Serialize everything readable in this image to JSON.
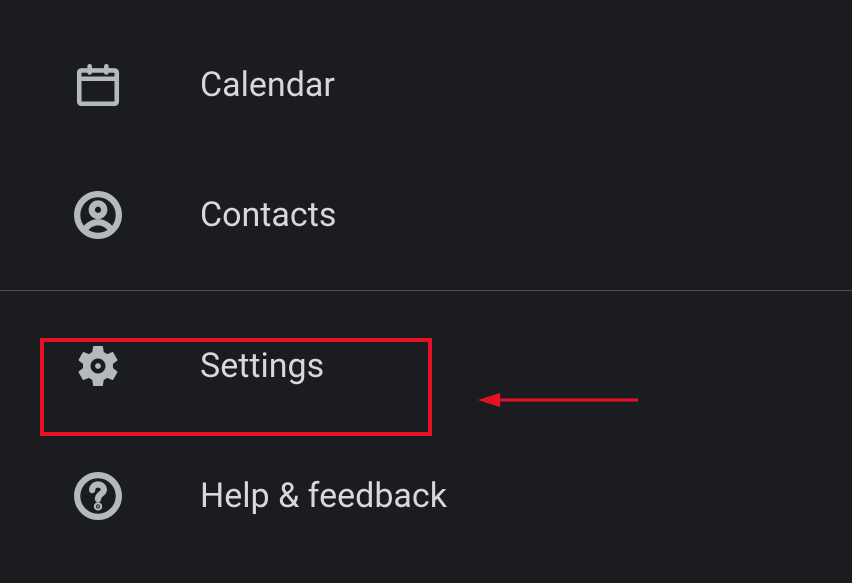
{
  "menu": {
    "items": [
      {
        "label": "Calendar"
      },
      {
        "label": "Contacts"
      },
      {
        "label": "Settings"
      },
      {
        "label": "Help & feedback"
      }
    ]
  },
  "annotation": {
    "highlighted_item": "Settings",
    "highlight_color": "#e81123"
  }
}
